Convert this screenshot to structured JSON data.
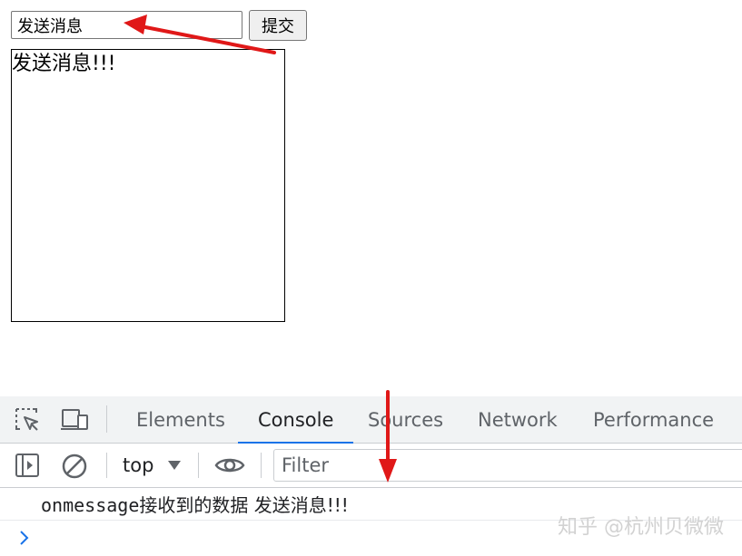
{
  "form": {
    "input_value": "发送消息",
    "submit_label": "提交"
  },
  "message_box": {
    "text": "发送消息!!!"
  },
  "devtools": {
    "tabs": [
      {
        "label": "Elements"
      },
      {
        "label": "Console"
      },
      {
        "label": "Sources"
      },
      {
        "label": "Network"
      },
      {
        "label": "Performance"
      }
    ],
    "active_tab": "Console",
    "toolbar": {
      "context": "top",
      "filter_placeholder": "Filter"
    },
    "console": {
      "line_prefix": "onmessage",
      "line_label": "接收到的数据 ",
      "line_value": "发送消息!!!"
    }
  },
  "watermark": "知乎 @杭州贝微微",
  "colors": {
    "annotation_arrow": "#e01818",
    "active_tab_underline": "#1a73e8",
    "toolbar_bg": "#f1f3f4"
  }
}
